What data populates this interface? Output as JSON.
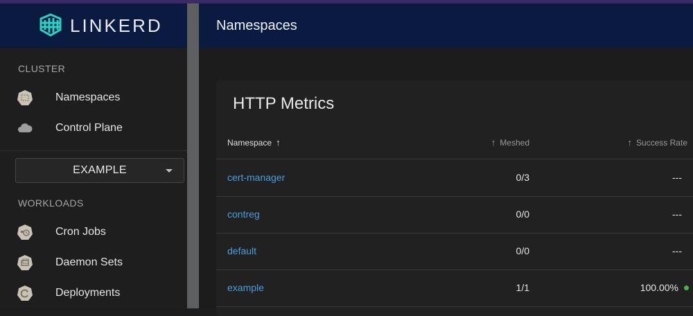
{
  "brand": {
    "name": "LINKERD"
  },
  "sidebar": {
    "cluster_title": "CLUSTER",
    "cluster_items": [
      {
        "label": "Namespaces",
        "icon": "namespace-icon"
      },
      {
        "label": "Control Plane",
        "icon": "cloud-icon"
      }
    ],
    "namespace_select": {
      "value": "EXAMPLE"
    },
    "workloads_title": "WORKLOADS",
    "workload_items": [
      {
        "label": "Cron Jobs",
        "icon": "cronjob-icon"
      },
      {
        "label": "Daemon Sets",
        "icon": "daemonset-icon"
      },
      {
        "label": "Deployments",
        "icon": "deployment-icon"
      }
    ]
  },
  "header": {
    "title": "Namespaces"
  },
  "card": {
    "title": "HTTP Metrics",
    "columns": {
      "namespace": "Namespace",
      "meshed": "Meshed",
      "success_rate": "Success Rate"
    },
    "rows": [
      {
        "namespace": "cert-manager",
        "meshed": "0/3",
        "success_rate": "---"
      },
      {
        "namespace": "contreg",
        "meshed": "0/0",
        "success_rate": "---"
      },
      {
        "namespace": "default",
        "meshed": "0/0",
        "success_rate": "---"
      },
      {
        "namespace": "example",
        "meshed": "1/1",
        "success_rate": "100.00%"
      }
    ]
  },
  "colors": {
    "header_bg": "#0a1a40",
    "link": "#4a9fe0",
    "status_ok": "#4caf50",
    "top_strip": "#3b2a63"
  }
}
